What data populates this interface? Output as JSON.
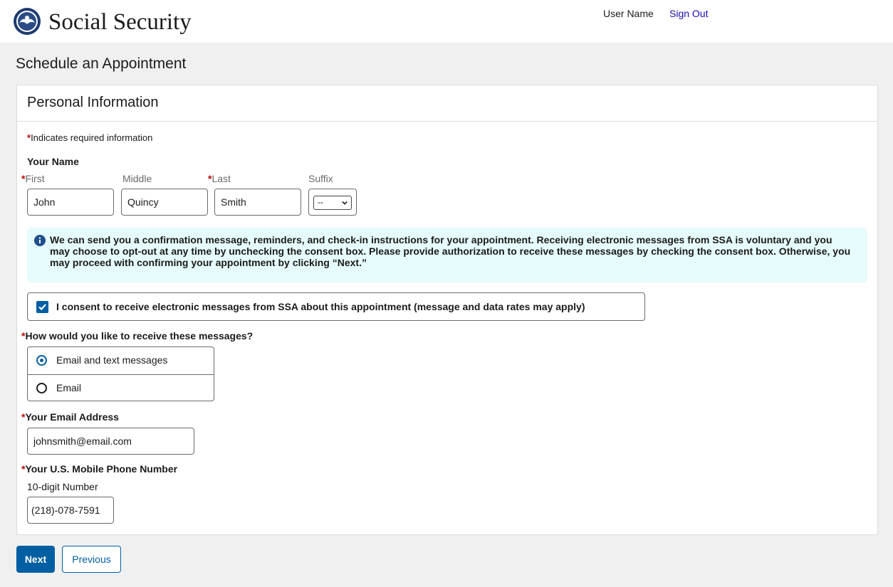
{
  "header": {
    "brand": "Social Security",
    "user_name": "User Name",
    "sign_out": "Sign Out",
    "logo_icon": "ssa-seal-icon"
  },
  "page": {
    "title": "Schedule an Appointment"
  },
  "panel": {
    "title": "Personal Information",
    "required_marker": "*",
    "required_note": "Indicates required information"
  },
  "name": {
    "section_label": "Your Name",
    "first": {
      "label": "First",
      "value": "John"
    },
    "middle": {
      "label": "Middle",
      "value": "Quincy"
    },
    "last": {
      "label": "Last",
      "value": "Smith"
    },
    "suffix": {
      "label": "Suffix",
      "value": "--"
    }
  },
  "info": {
    "icon": "info-circle-icon",
    "text": "We can send you a confirmation message, reminders, and check-in instructions for your appointment. Receiving electronic messages from SSA is voluntary and you may choose to opt-out at any time by unchecking the consent box. Please provide authorization to receive these messages by checking the consent box.  Otherwise, you may proceed with confirming your appointment by clicking “Next.”"
  },
  "consent": {
    "label": "I consent to receive electronic messages from SSA about this appointment (message and data rates may apply)",
    "checked": true
  },
  "delivery": {
    "question": "How would you like to receive these messages?",
    "options": [
      {
        "label": "Email and text messages",
        "selected": true
      },
      {
        "label": "Email",
        "selected": false
      }
    ]
  },
  "email": {
    "label": "Your Email Address",
    "value": "johnsmith@email.com"
  },
  "phone": {
    "label": "Your U.S. Mobile Phone Number",
    "hint": "10-digit Number",
    "value": "(218)-078-7591"
  },
  "buttons": {
    "next": "Next",
    "previous": "Previous"
  },
  "colors": {
    "primary": "#005ea2",
    "required": "#b50909",
    "info_bg": "#e6fbfb",
    "link": "#1a0dab"
  }
}
